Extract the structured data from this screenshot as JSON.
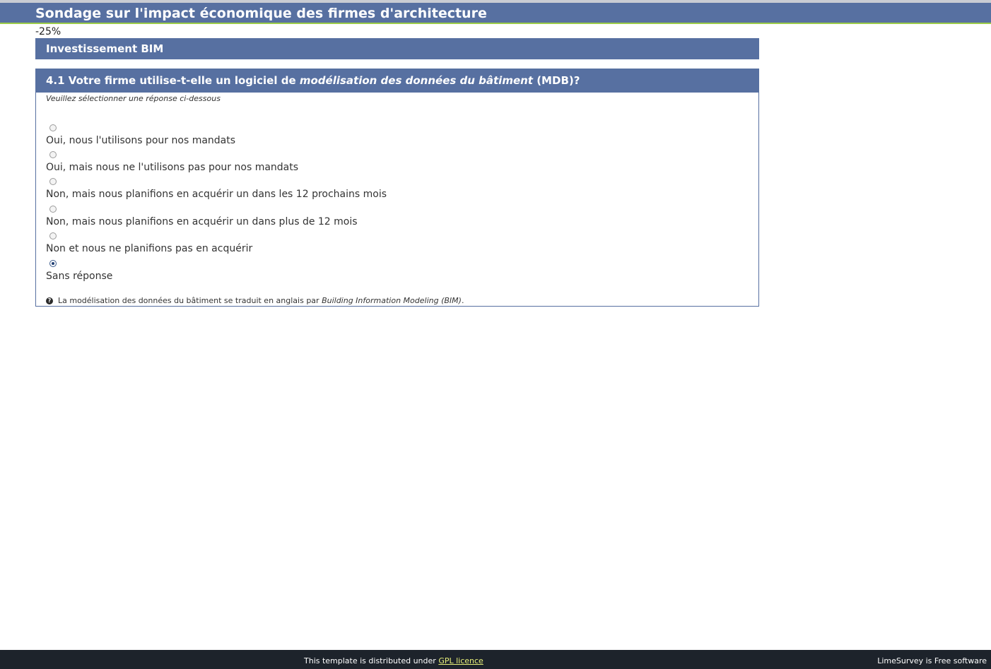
{
  "survey": {
    "title": "Sondage sur l'impact économique des firmes d'architecture",
    "progress": "-25%"
  },
  "group": {
    "title": "Investissement BIM"
  },
  "question": {
    "text_prefix": "4.1 Votre firme utilise-t-elle un logiciel de ",
    "text_italic": "modélisation des données du bâtiment",
    "text_suffix": " (MDB)?",
    "instruction": "Veuillez sélectionner une réponse ci-dessous",
    "options": [
      {
        "label": "Oui, nous l'utilisons pour nos mandats",
        "checked": false
      },
      {
        "label": "Oui, mais nous ne l'utilisons pas pour nos mandats",
        "checked": false
      },
      {
        "label": "Non, mais nous planifions en acquérir un dans les 12 prochains mois",
        "checked": false
      },
      {
        "label": "Non, mais nous planifions en acquérir un dans plus de 12 mois",
        "checked": false
      },
      {
        "label": "Non et nous ne planifions pas en acquérir",
        "checked": false
      },
      {
        "label": "Sans réponse",
        "checked": true
      }
    ],
    "help": {
      "icon": "help-icon",
      "text_prefix": "La modélisation des données du bâtiment se traduit en anglais par ",
      "text_italic": "Building Information Modeling (BIM)",
      "text_suffix": "."
    }
  },
  "footer": {
    "text_prefix": "This template is distributed under ",
    "link_label": "GPL licence",
    "right_text": "LimeSurvey is Free software"
  },
  "colors": {
    "header_bg": "#5770a1",
    "header_accent": "#9ccc48",
    "footer_bg": "#1d232b",
    "footer_link": "#e8f07a"
  }
}
